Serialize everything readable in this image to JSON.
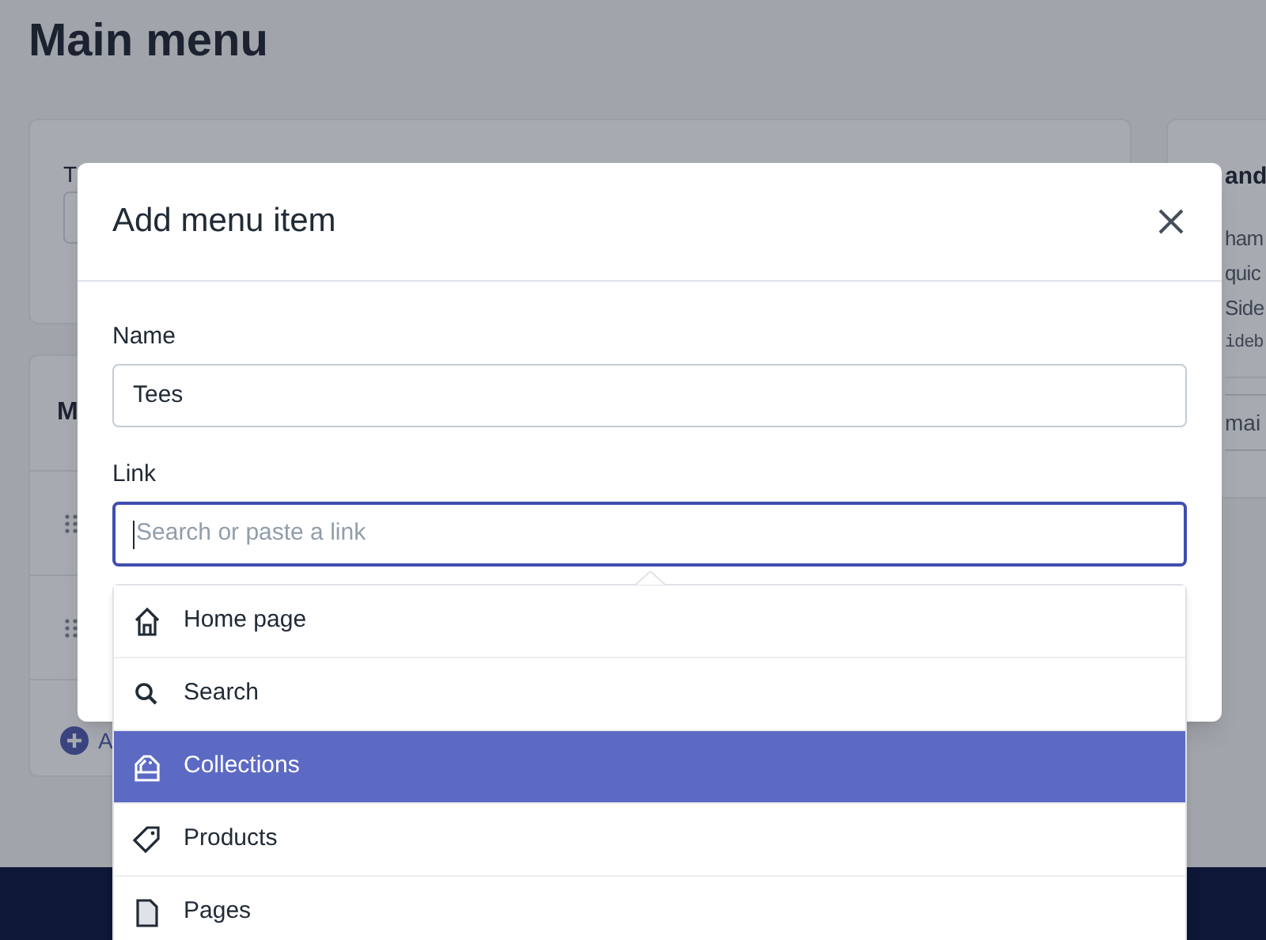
{
  "page": {
    "title": "Main menu"
  },
  "title_card": {
    "label": "T"
  },
  "items_card": {
    "heading": "M",
    "rows": [
      {
        "kind": "drag-row"
      },
      {
        "kind": "drag-row"
      }
    ],
    "add_link": "A"
  },
  "side_card": {
    "heading": "and",
    "lines": [
      "ham",
      "quic",
      "Side"
    ],
    "code": "ideb",
    "field_value": "mai"
  },
  "modal": {
    "title": "Add menu item",
    "name_field": {
      "label": "Name",
      "value": "Tees"
    },
    "link_field": {
      "label": "Link",
      "placeholder": "Search or paste a link",
      "focused": true
    }
  },
  "dropdown": [
    {
      "kind": "home",
      "label": "Home page",
      "selected": false
    },
    {
      "kind": "search",
      "label": "Search",
      "selected": false
    },
    {
      "kind": "collections",
      "label": "Collections",
      "selected": true
    },
    {
      "kind": "products",
      "label": "Products",
      "selected": false
    },
    {
      "kind": "pages",
      "label": "Pages",
      "selected": false
    }
  ]
}
